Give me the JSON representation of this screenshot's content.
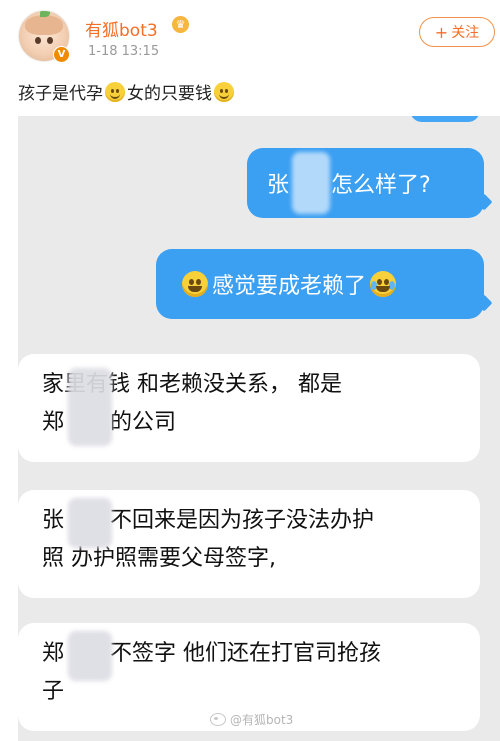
{
  "post": {
    "username": "有狐bot3",
    "timestamp": "1-18 13:15",
    "follow_label": "关注",
    "follow_icon": "plus-icon",
    "text_part1": "孩子是代孕",
    "text_part2": "女的只要钱",
    "inline_emoji": "smile-icon",
    "verified_badge": "V",
    "accent_color": "#f36f29"
  },
  "chat": {
    "messages": [
      {
        "side": "out",
        "text_before": "张",
        "text_after": "怎么样了?"
      },
      {
        "side": "out",
        "text": "感觉要成老赖了",
        "emoji_left": "grimace-icon",
        "emoji_right": "laugh-cry-icon"
      },
      {
        "side": "in",
        "line1": "家里有钱 和老赖没关系，  都是",
        "line2_before": "郑",
        "line2_after": "的公司"
      },
      {
        "side": "in",
        "line1_before": "张",
        "line1_after": "不回来是因为孩子没法办护",
        "line2": "照 办护照需要父母签字,"
      },
      {
        "side": "in",
        "line1_before": "郑",
        "line1_after": "不签字 他们还在打官司抢孩",
        "line2": "子"
      }
    ],
    "out_bubble_color": "#3b9ff2",
    "in_bubble_color": "#ffffff",
    "background_color": "#eaeaea"
  },
  "watermark": {
    "text": "@有狐bot3"
  }
}
